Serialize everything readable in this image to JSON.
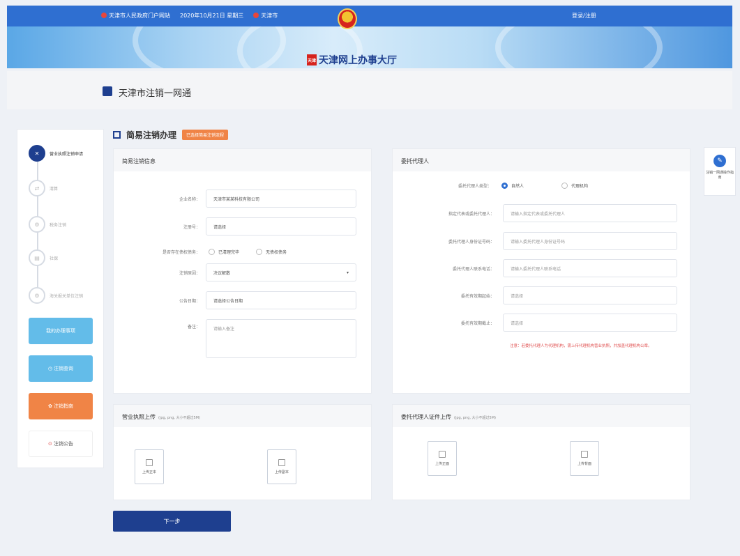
{
  "header": {
    "left_items": [
      "天津市人民政府门户网站",
      "2020年10月21日 星期三",
      "天津市"
    ],
    "right_item": "登录/注册",
    "site_title": "天津网上办事大厅",
    "seal_text": "天津"
  },
  "page_title": "天津市注销一网通",
  "section": {
    "title": "简易注销办理",
    "tag": "已选择简易注销流程"
  },
  "steps": [
    {
      "label": "营业执照注销申请",
      "icon": "✕"
    },
    {
      "label": "清算",
      "icon": "⇄"
    },
    {
      "label": "税务注销",
      "icon": "⚙"
    },
    {
      "label": "社保",
      "icon": "▤"
    },
    {
      "label": "海关报关单位注销",
      "icon": "⚙"
    }
  ],
  "side_buttons": {
    "btn1": "我的办理事项",
    "btn2": "注销查询",
    "btn3": "注销指南",
    "btn4": "注销公告"
  },
  "left_card": {
    "title": "简易注销信息",
    "fields": [
      {
        "label": "企业名称：",
        "value": "天津市某某科技有限公司"
      },
      {
        "label": "注册号：",
        "value": "请选择"
      }
    ],
    "radio_label": "是否存在债权债务：",
    "radio_options": [
      "已清理完毕",
      "无债权债务"
    ],
    "select": {
      "label": "注销原因：",
      "value": "决议解散"
    },
    "date": {
      "label": "公告日期：",
      "value": "请选择公告日期"
    },
    "remark": {
      "label": "备注：",
      "placeholder": "请输入备注"
    }
  },
  "right_card": {
    "title": "委托代理人",
    "radio_label": "委托代理人类型：",
    "radio_options": [
      "自然人",
      "代理机构"
    ],
    "fields": [
      {
        "label": "指定代表或委托代理人：",
        "placeholder": "请输入指定代表或委托代理人"
      },
      {
        "label": "委托代理人身份证号码：",
        "placeholder": "请输入委托代理人身份证号码"
      },
      {
        "label": "委托代理人联系电话：",
        "placeholder": "请输入委托代理人联系电话"
      },
      {
        "label": "委托有效期起始：",
        "placeholder": "请选择"
      },
      {
        "label": "委托有效期截止：",
        "placeholder": "请选择"
      }
    ],
    "note": "注意：若委托代理人为代理机构，需上传代理机构营业执照，并加盖代理机构公章。"
  },
  "upload_left": {
    "title": "营业执照上传",
    "hint": "(jpg, png, 大小不超过5M)",
    "boxes": [
      "上传正本",
      "上传副本"
    ]
  },
  "upload_right": {
    "title": "委托代理人证件上传",
    "hint": "(jpg, png, 大小不超过5M)",
    "boxes": [
      "上传正面",
      "上传背面"
    ]
  },
  "next_button": "下一步",
  "float_help": {
    "text": "注销一网通操作指南",
    "icon": "help-icon"
  },
  "colors": {
    "primary": "#1e3f8f",
    "accent": "#2f6fd1",
    "orange": "#f08446",
    "light_blue": "#63bce9"
  }
}
